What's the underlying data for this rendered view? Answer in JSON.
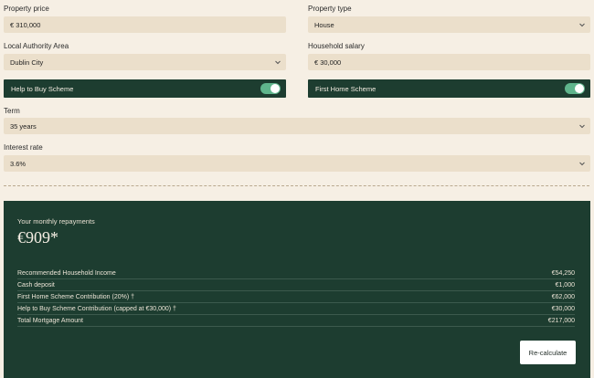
{
  "form": {
    "property_price": {
      "label": "Property price",
      "value": "€ 310,000"
    },
    "property_type": {
      "label": "Property type",
      "value": "House"
    },
    "local_authority": {
      "label": "Local Authority Area",
      "value": "Dublin City"
    },
    "household_salary": {
      "label": "Household salary",
      "value": "€ 30,000"
    },
    "help_to_buy": {
      "label": "Help to Buy Scheme",
      "enabled": true
    },
    "first_home": {
      "label": "First Home Scheme",
      "enabled": true
    },
    "term": {
      "label": "Term",
      "value": "35 years"
    },
    "interest_rate": {
      "label": "Interest rate",
      "value": "3.6%"
    }
  },
  "result": {
    "title": "Your monthly repayments",
    "amount": "€909*",
    "rows": [
      {
        "label": "Recommended Household Income",
        "value": "€54,250"
      },
      {
        "label": "Cash deposit",
        "value": "€1,000"
      },
      {
        "label": "First Home Scheme Contribution (20%) †",
        "value": "€62,000"
      },
      {
        "label": "Help to Buy Scheme Contribution (capped at €30,000) †",
        "value": "€30,000"
      },
      {
        "label": "Total Mortgage Amount",
        "value": "€217,000"
      }
    ],
    "recalculate_label": "Re-calculate"
  },
  "colors": {
    "dark_green": "#1d3d30",
    "field_beige": "#ebdfcb",
    "page_bg": "#f6efe4",
    "toggle_on": "#5fb58c"
  },
  "icons": {
    "dropdown": "chevron-down-icon"
  }
}
